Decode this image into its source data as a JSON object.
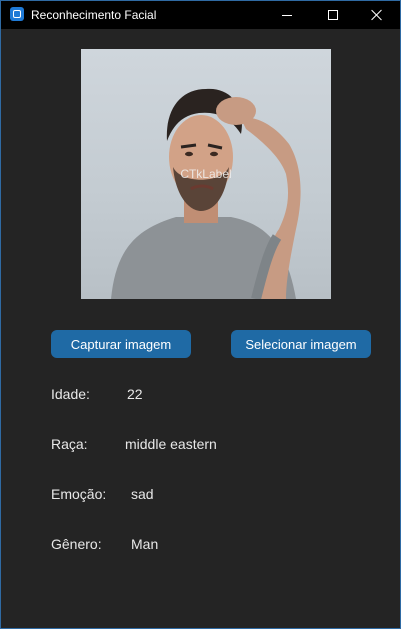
{
  "window": {
    "title": "Reconhecimento Facial"
  },
  "photo": {
    "overlay_label": "CTkLabel"
  },
  "buttons": {
    "capture_label": "Capturar imagem",
    "select_label": "Selecionar imagem"
  },
  "results": [
    {
      "label": "Idade:",
      "value": "22"
    },
    {
      "label": "Raça:",
      "value": "middle eastern"
    },
    {
      "label": "Emoção:",
      "value": "sad"
    },
    {
      "label": "Gênero:",
      "value": "Man"
    }
  ],
  "colors": {
    "background": "#242424",
    "titlebar": "#000000",
    "button": "#1f6aa5",
    "text": "#e8e8e8"
  }
}
